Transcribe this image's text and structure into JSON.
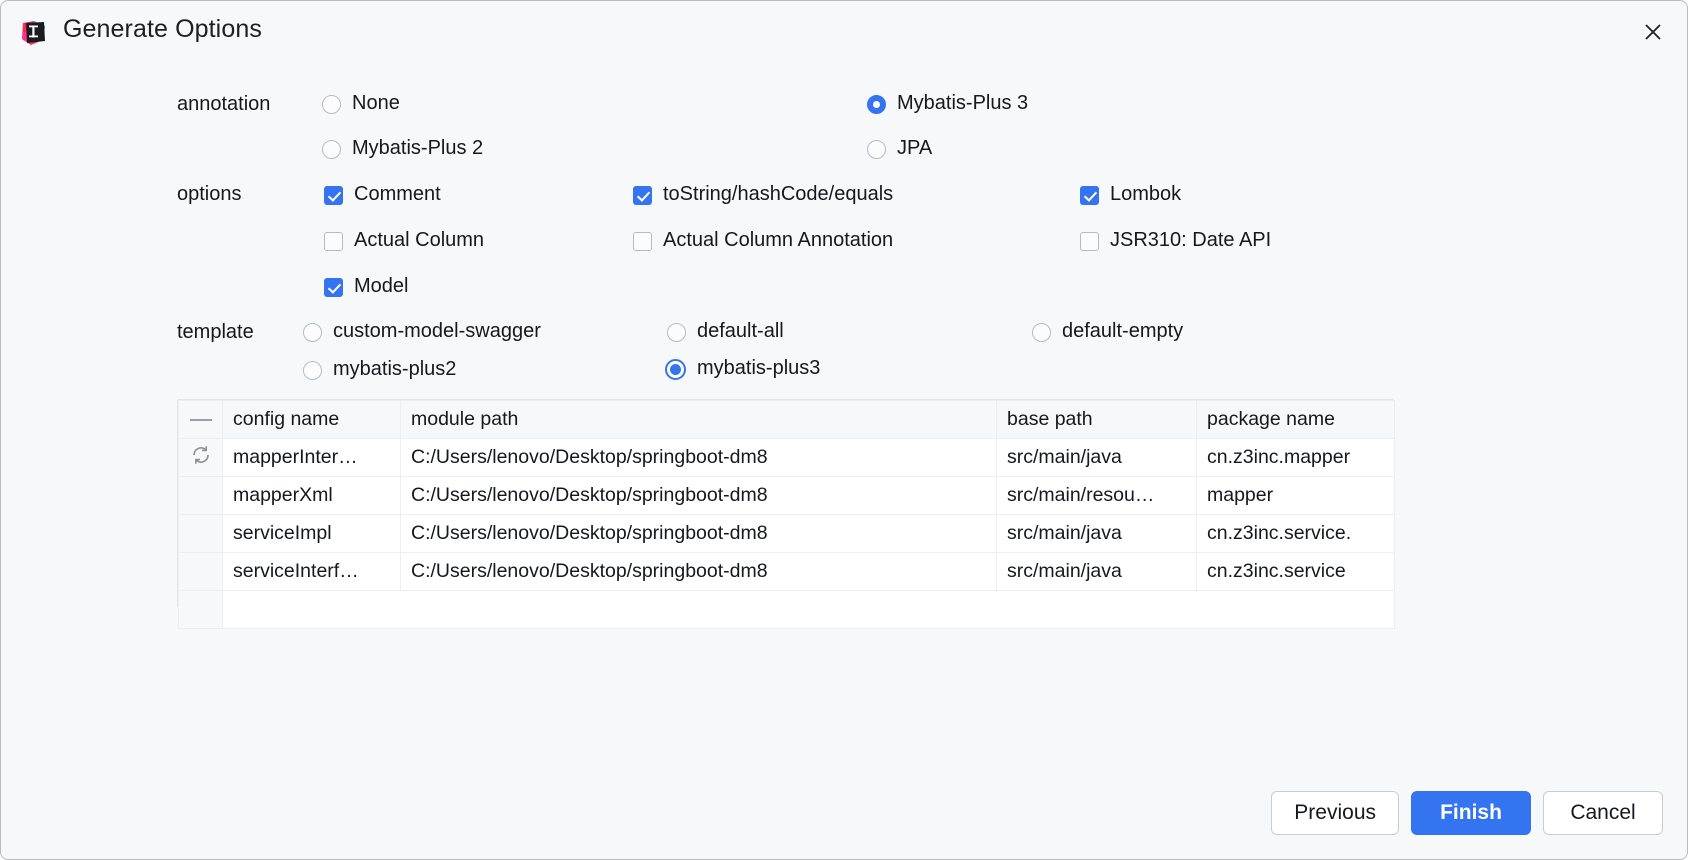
{
  "window": {
    "title": "Generate Options",
    "app_icon": "intellij-idea-icon",
    "close_icon": "close-icon"
  },
  "form": {
    "annotation": {
      "label": "annotation",
      "options": [
        {
          "label": "None",
          "selected": false
        },
        {
          "label": "Mybatis-Plus 3",
          "selected": true
        },
        {
          "label": "Mybatis-Plus 2",
          "selected": false
        },
        {
          "label": "JPA",
          "selected": false
        }
      ]
    },
    "options": {
      "label": "options",
      "items": [
        {
          "label": "Comment",
          "checked": true
        },
        {
          "label": "toString/hashCode/equals",
          "checked": true
        },
        {
          "label": "Lombok",
          "checked": true
        },
        {
          "label": "Actual Column",
          "checked": false
        },
        {
          "label": "Actual Column Annotation",
          "checked": false
        },
        {
          "label": "JSR310: Date API",
          "checked": false
        },
        {
          "label": "Model",
          "checked": true
        }
      ]
    },
    "template": {
      "label": "template",
      "options": [
        {
          "label": "custom-model-swagger",
          "selected": false
        },
        {
          "label": "default-all",
          "selected": false
        },
        {
          "label": "default-empty",
          "selected": false
        },
        {
          "label": "mybatis-plus2",
          "selected": false
        },
        {
          "label": "mybatis-plus3",
          "selected": true
        }
      ]
    }
  },
  "table": {
    "headers": {
      "icon": "—",
      "config_name": "config name",
      "module_path": "module path",
      "base_path": "base path",
      "package_name": "package name"
    },
    "rows": [
      {
        "icon": "refresh-icon",
        "config_name": "mapperInter…",
        "module_path": "C:/Users/lenovo/Desktop/springboot-dm8",
        "base_path": "src/main/java",
        "package_name": "cn.z3inc.mapper"
      },
      {
        "icon": "",
        "config_name": "mapperXml",
        "module_path": "C:/Users/lenovo/Desktop/springboot-dm8",
        "base_path": "src/main/resou…",
        "package_name": "mapper"
      },
      {
        "icon": "",
        "config_name": "serviceImpl",
        "module_path": "C:/Users/lenovo/Desktop/springboot-dm8",
        "base_path": "src/main/java",
        "package_name": "cn.z3inc.service."
      },
      {
        "icon": "",
        "config_name": "serviceInterf…",
        "module_path": "C:/Users/lenovo/Desktop/springboot-dm8",
        "base_path": "src/main/java",
        "package_name": "cn.z3inc.service"
      }
    ]
  },
  "footer": {
    "previous": "Previous",
    "finish": "Finish",
    "cancel": "Cancel"
  },
  "colors": {
    "accent": "#3574f0",
    "background": "#f7f8fa",
    "text": "#15181c",
    "border": "#c9ccd1"
  }
}
